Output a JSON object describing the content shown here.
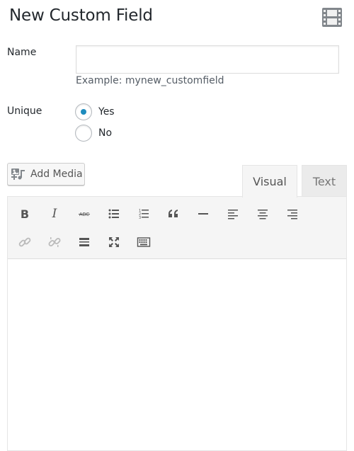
{
  "page": {
    "title": "New Custom Field",
    "film_icon": "film-strip-icon"
  },
  "form": {
    "name_label": "Name",
    "name_value": "",
    "name_hint": "Example: mynew_customfield",
    "unique_label": "Unique",
    "unique_options": [
      {
        "label": "Yes",
        "checked": true
      },
      {
        "label": "No",
        "checked": false
      }
    ]
  },
  "editor": {
    "add_media_label": "Add Media",
    "add_media_icon": "add-media-icon",
    "tabs": [
      {
        "label": "Visual",
        "active": true
      },
      {
        "label": "Text",
        "active": false
      }
    ],
    "toolbar": [
      {
        "name": "bold",
        "icon": "bold-icon"
      },
      {
        "name": "italic",
        "icon": "italic-icon"
      },
      {
        "name": "strikethrough",
        "icon": "strikethrough-icon"
      },
      {
        "name": "bulleted-list",
        "icon": "bulleted-list-icon"
      },
      {
        "name": "numbered-list",
        "icon": "numbered-list-icon"
      },
      {
        "name": "blockquote",
        "icon": "blockquote-icon"
      },
      {
        "name": "horizontal-line",
        "icon": "horizontal-line-icon"
      },
      {
        "name": "align-left",
        "icon": "align-left-icon"
      },
      {
        "name": "align-center",
        "icon": "align-center-icon"
      },
      {
        "name": "align-right",
        "icon": "align-right-icon"
      },
      {
        "name": "insert-link",
        "icon": "link-icon",
        "disabled": true
      },
      {
        "name": "remove-link",
        "icon": "unlink-icon",
        "disabled": true
      },
      {
        "name": "read-more",
        "icon": "read-more-icon"
      },
      {
        "name": "fullscreen",
        "icon": "fullscreen-icon"
      },
      {
        "name": "toolbar-toggle",
        "icon": "keyboard-icon"
      }
    ],
    "content": ""
  },
  "colors": {
    "accent": "#1e8cbe",
    "text": "#23282d",
    "toolbar_bg": "#f5f5f5",
    "border": "#e5e5e5"
  }
}
